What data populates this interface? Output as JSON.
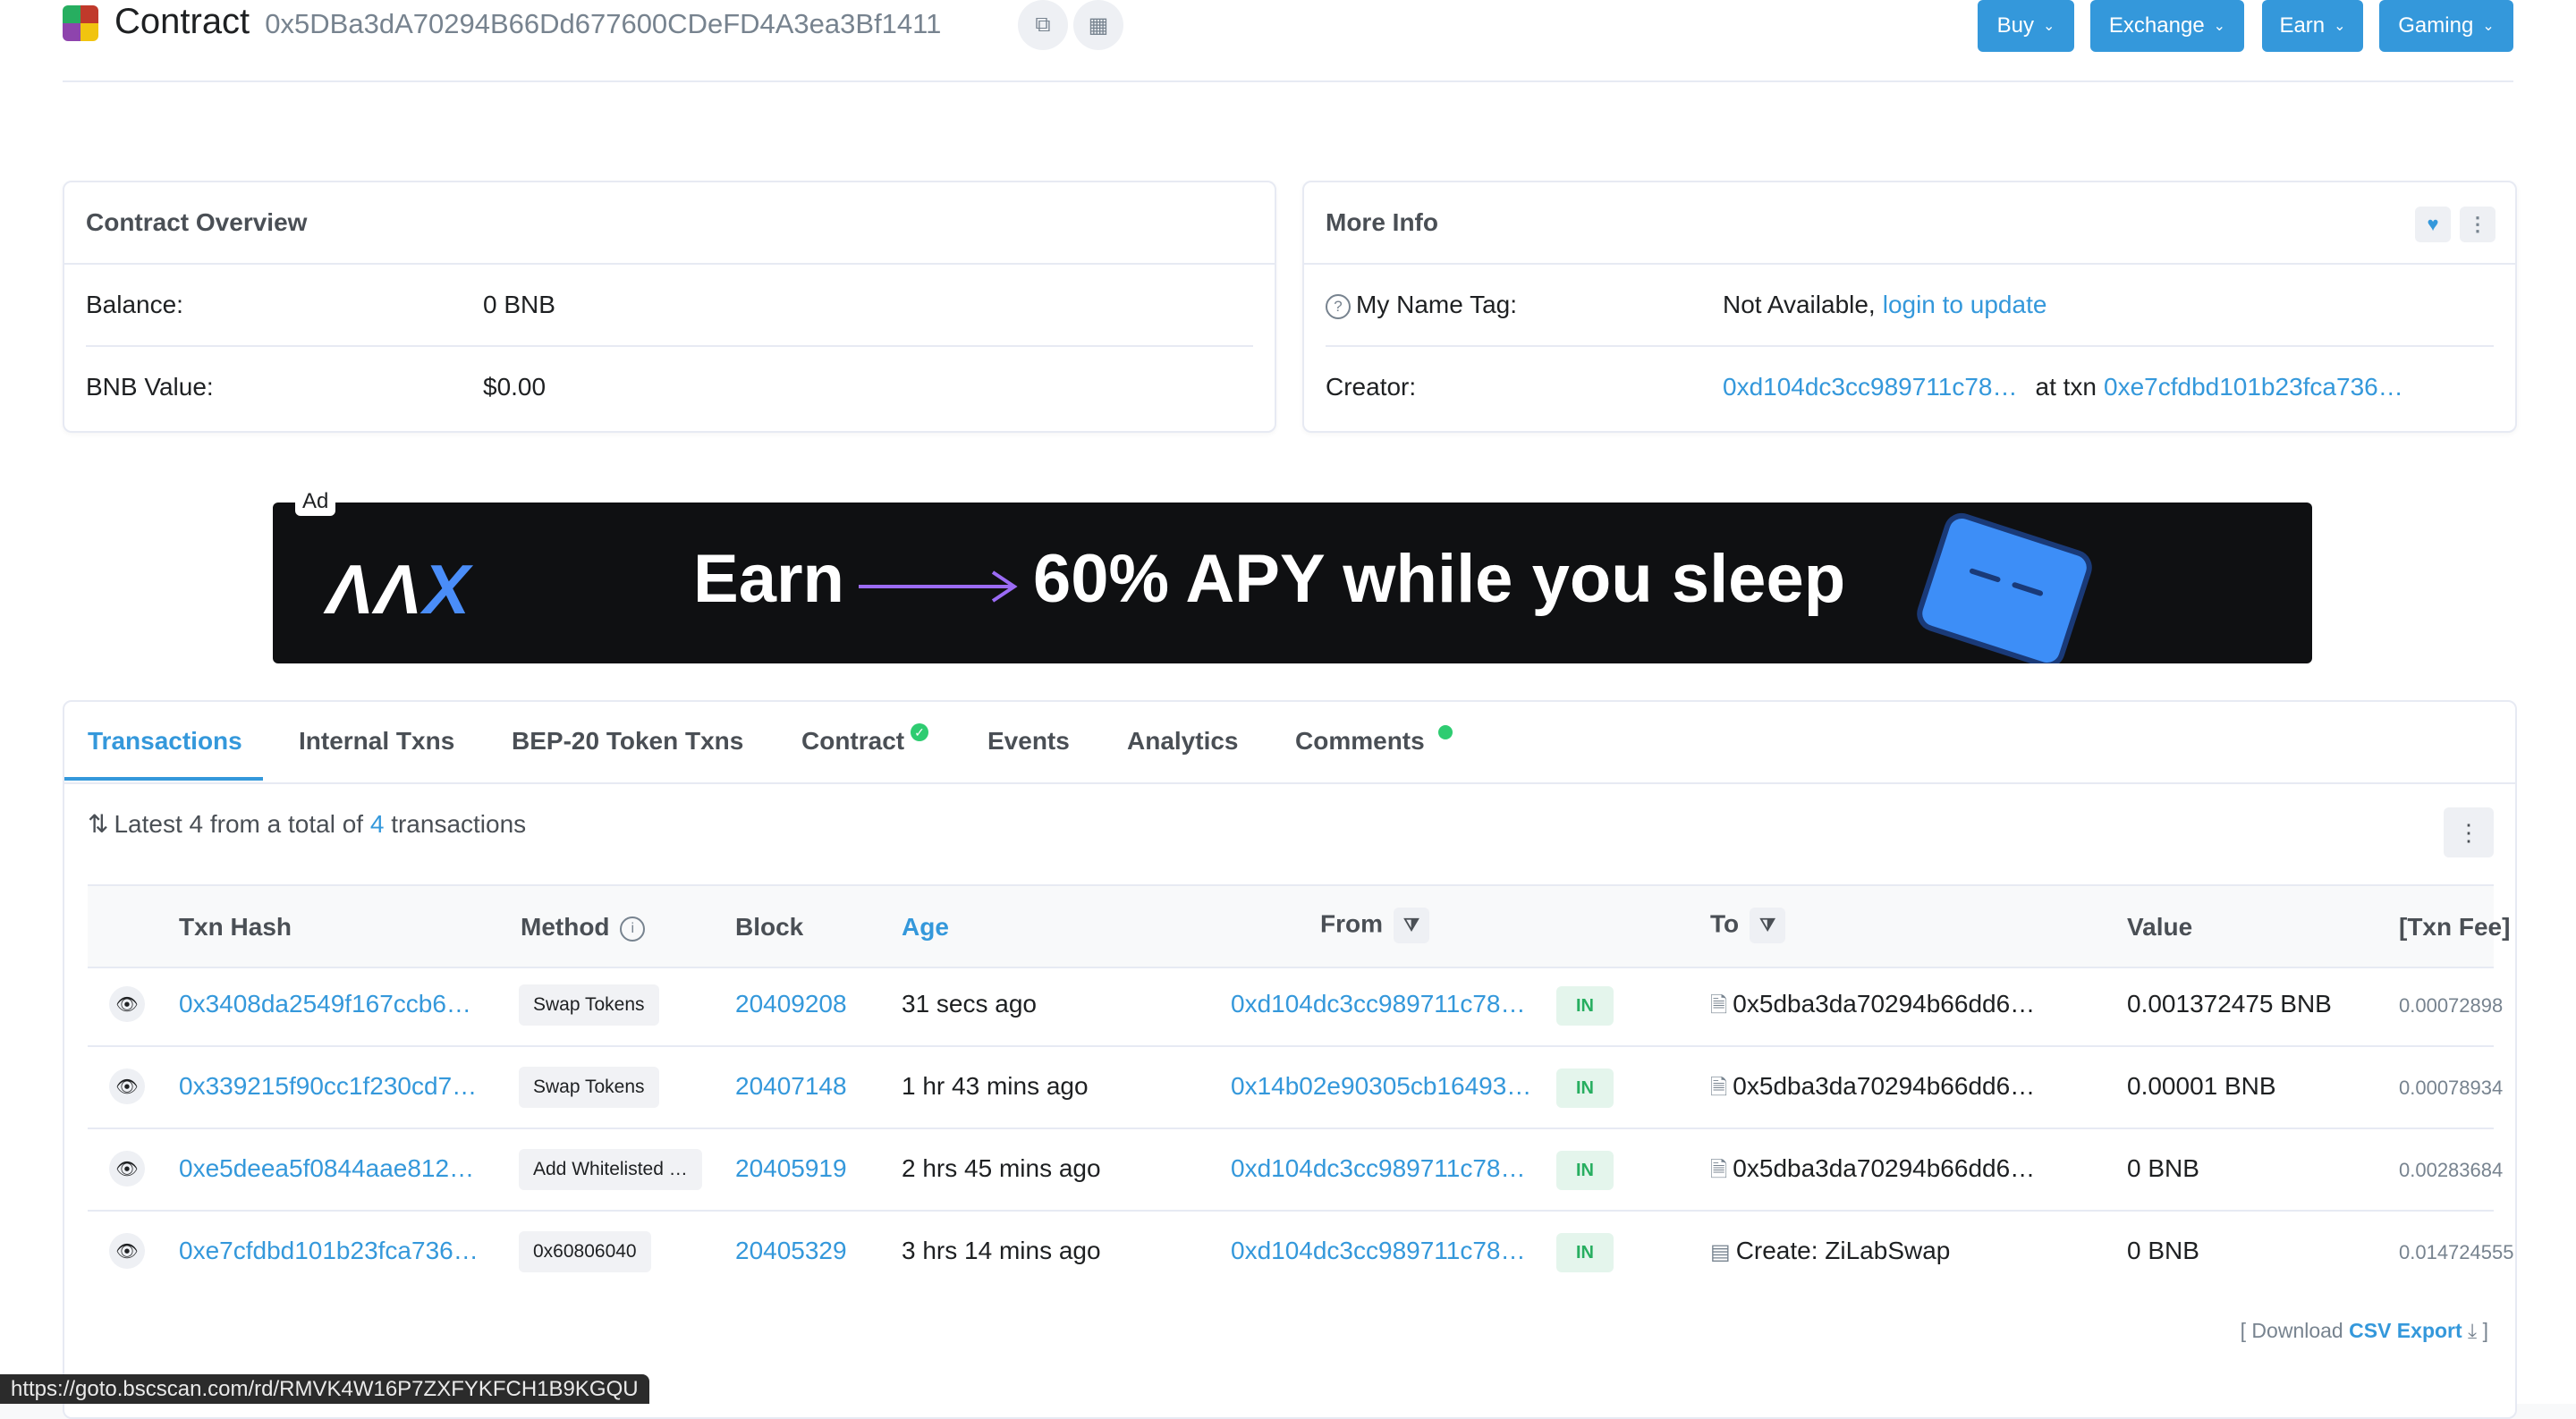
{
  "header": {
    "title": "Contract",
    "address": "0x5DBa3dA70294B66Dd677600CDeFD4A3ea3Bf1411",
    "nav": [
      {
        "label": "Buy"
      },
      {
        "label": "Exchange"
      },
      {
        "label": "Earn"
      },
      {
        "label": "Gaming"
      }
    ]
  },
  "overview": {
    "title": "Contract Overview",
    "balance_label": "Balance:",
    "balance_value": "0 BNB",
    "value_label": "BNB Value:",
    "value_value": "$0.00"
  },
  "more_info": {
    "title": "More Info",
    "name_tag_label": "My Name Tag:",
    "name_tag_value": "Not Available,",
    "name_tag_link": "login to update",
    "creator_label": "Creator:",
    "creator_address": "0xd104dc3cc989711c78…",
    "creator_at": "at txn",
    "creator_txn": "0xe7cfdbd101b23fca736…"
  },
  "ad": {
    "tag": "Ad",
    "brand_a": "ΛΛ",
    "brand_x": "X",
    "earn": "Earn",
    "headline": "60% APY while you sleep"
  },
  "tabs": [
    {
      "label": "Transactions"
    },
    {
      "label": "Internal Txns"
    },
    {
      "label": "BEP-20 Token Txns"
    },
    {
      "label": "Contract"
    },
    {
      "label": "Events"
    },
    {
      "label": "Analytics"
    },
    {
      "label": "Comments"
    }
  ],
  "summary": {
    "prefix": "Latest 4 from a total of",
    "count": "4",
    "suffix": "transactions"
  },
  "table": {
    "headers": {
      "hash": "Txn Hash",
      "method": "Method",
      "block": "Block",
      "age": "Age",
      "from": "From",
      "to": "To",
      "value": "Value",
      "fee": "[Txn Fee]"
    },
    "rows": [
      {
        "hash": "0x3408da2549f167ccb6…",
        "method": "Swap Tokens",
        "block": "20409208",
        "age": "31 secs ago",
        "from": "0xd104dc3cc989711c78…",
        "dir": "IN",
        "to": "0x5dba3da70294b66dd6…",
        "value": "0.001372475 BNB",
        "fee": "0.00072898"
      },
      {
        "hash": "0x339215f90cc1f230cd7…",
        "method": "Swap Tokens",
        "block": "20407148",
        "age": "1 hr 43 mins ago",
        "from": "0x14b02e90305cb16493…",
        "dir": "IN",
        "to": "0x5dba3da70294b66dd6…",
        "value": "0.00001 BNB",
        "fee": "0.00078934"
      },
      {
        "hash": "0xe5deea5f0844aae812…",
        "method": "Add Whitelisted …",
        "block": "20405919",
        "age": "2 hrs 45 mins ago",
        "from": "0xd104dc3cc989711c78…",
        "dir": "IN",
        "to": "0x5dba3da70294b66dd6…",
        "value": "0 BNB",
        "fee": "0.00283684"
      },
      {
        "hash": "0xe7cfdbd101b23fca736…",
        "method": "0x60806040",
        "block": "20405329",
        "age": "3 hrs 14 mins ago",
        "from": "0xd104dc3cc989711c78…",
        "dir": "IN",
        "to": "Create: ZiLabSwap",
        "value": "0 BNB",
        "fee": "0.014724555"
      }
    ]
  },
  "footer": {
    "download_prefix": "[ Download",
    "csv": "CSV Export",
    "download_suffix": "]"
  },
  "status_url": "https://goto.bscscan.com/rd/RMVK4W16P7ZXFYKFCH1B9KGQU"
}
